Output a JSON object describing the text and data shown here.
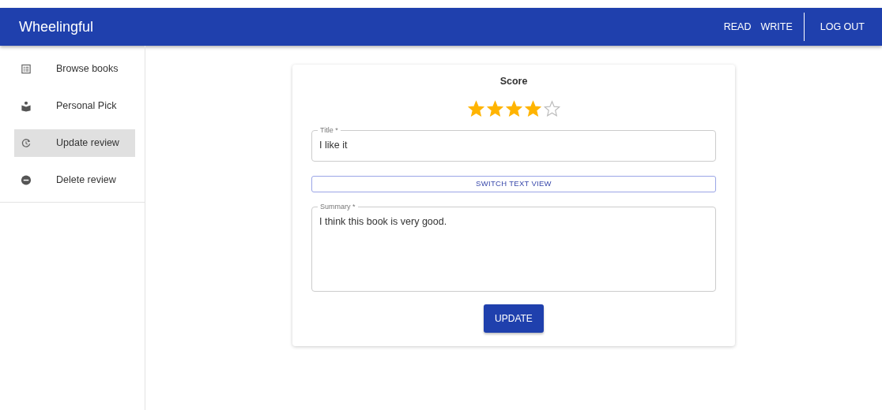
{
  "app_bar": {
    "title": "Wheelingful",
    "links": [
      {
        "label": "READ"
      },
      {
        "label": "WRITE"
      }
    ],
    "logout": "LOG OUT"
  },
  "sidebar": {
    "items": [
      {
        "label": "Browse books",
        "kind": "list",
        "selected": false
      },
      {
        "label": "Personal Pick",
        "kind": "reader",
        "selected": false
      },
      {
        "label": "Update review",
        "kind": "update",
        "selected": true
      },
      {
        "label": "Delete review",
        "kind": "remove",
        "selected": false
      }
    ]
  },
  "form": {
    "score_label": "Score",
    "stars": 4,
    "title_field": {
      "label": "Title *",
      "value": "I like it"
    },
    "switch_button": "SWITCH TEXT VIEW",
    "summary_field": {
      "label": "Summary *",
      "value": "I think this book is very good."
    },
    "submit": "UPDATE"
  }
}
